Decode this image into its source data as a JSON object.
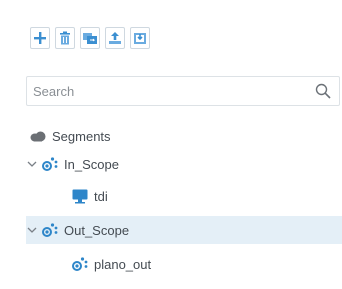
{
  "toolbar": {
    "buttons": [
      {
        "icon": "plus-icon"
      },
      {
        "icon": "trash-icon"
      },
      {
        "icon": "move-icon"
      },
      {
        "icon": "export-icon"
      },
      {
        "icon": "import-icon"
      }
    ]
  },
  "search": {
    "placeholder": "Search",
    "value": ""
  },
  "tree": {
    "root_label": "Segments",
    "groups": [
      {
        "label": "In_Scope",
        "expanded": true,
        "children": [
          {
            "label": "tdi",
            "icon": "computer-icon"
          }
        ]
      },
      {
        "label": "Out_Scope",
        "expanded": true,
        "selected": true,
        "children": [
          {
            "label": "plano_out",
            "icon": "segment-icon"
          }
        ]
      }
    ]
  },
  "colors": {
    "accent": "#2e86c9",
    "selected_row": "#e4eff7",
    "toolbar_border": "#cfd8e0"
  }
}
